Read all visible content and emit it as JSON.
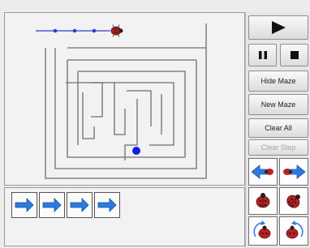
{
  "controls": {
    "play_icon": "play-icon",
    "pause_icon": "pause-icon",
    "stop_icon": "stop-icon"
  },
  "buttons": {
    "hide_maze": "Hide Maze",
    "new_maze": "New Maze",
    "clear_all": "Clear All",
    "clear_step": "Clear Step"
  },
  "command_palette": [
    {
      "icon": "turn-left-arrow-icon"
    },
    {
      "icon": "turn-right-arrow-icon"
    },
    {
      "icon": "ladybug-icon"
    },
    {
      "icon": "ladybug-icon"
    },
    {
      "icon": "ladybug-rotate-left-icon"
    },
    {
      "icon": "ladybug-rotate-right-icon"
    }
  ],
  "program_steps": [
    {
      "icon": "forward-arrow-icon"
    },
    {
      "icon": "forward-arrow-icon"
    },
    {
      "icon": "forward-arrow-icon"
    },
    {
      "icon": "forward-arrow-icon"
    }
  ],
  "colors": {
    "maze_wall": "#6e6e6e",
    "path_line": "#2e3fc9",
    "goal_dot": "#1020e0",
    "arrow_fill": "#2c7be0",
    "ladybug_red": "#b82020"
  }
}
